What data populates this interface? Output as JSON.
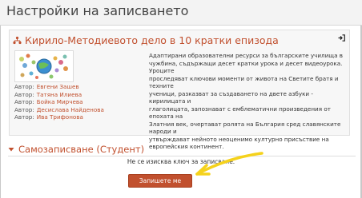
{
  "page": {
    "title": "Настройки на записването"
  },
  "course": {
    "name": "Кирило-Методиевото дело в 10 кратки епизода",
    "teachers": [
      {
        "role": "Автор:",
        "name": "Евгени Зашев"
      },
      {
        "role": "Автор:",
        "name": "Татяна Илиева"
      },
      {
        "role": "Автор:",
        "name": "Бойка Мирчева"
      },
      {
        "role": "Автор:",
        "name": "Десислава Найденова"
      },
      {
        "role": "Автор:",
        "name": "Ива Трифонова"
      }
    ],
    "summary_lines": [
      "Адаптирани образователни ресурси за българските училища в",
      "чужбина, съдържащи десет кратки урока и десет видеоурока. Уроците",
      "проследяват ключови моменти от живота на Светите братя и техните",
      "ученици, разказват за създаването на двете азбуки - кирилицата и",
      "глаголицата, запознават с емблематични произведения от епохата на",
      "Златния век, очертават ролята на България сред славянските народи и",
      "утвърждават нейното неоценимо културно присъствие на",
      "европейския континент."
    ]
  },
  "enrolment": {
    "title": "Самозаписване (Студент)",
    "no_key_message": "Не се изисква ключ за записване.",
    "button_label": "Запишете ме"
  },
  "icons": {
    "course": "tree-icon",
    "signin": "sign-in-icon",
    "collapse": "caret-down-icon"
  },
  "colors": {
    "accent": "#c1502e",
    "highlight": "#f5d21c",
    "header_bg": "#f3f3f3"
  }
}
